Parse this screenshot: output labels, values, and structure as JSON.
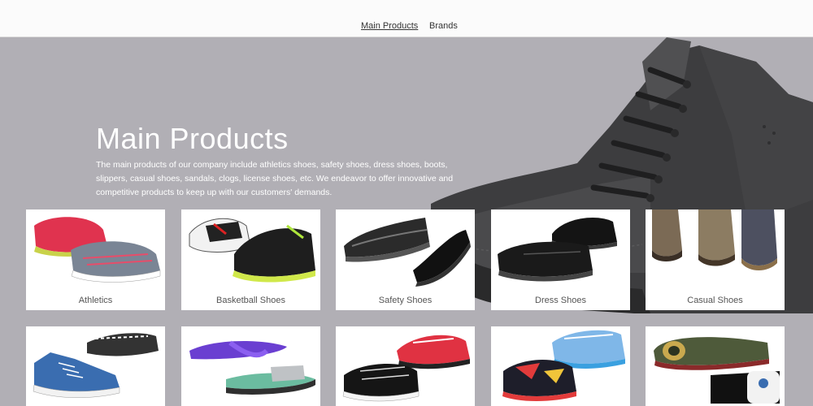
{
  "nav": {
    "items": [
      {
        "label": "Main Products",
        "active": true
      },
      {
        "label": "Brands",
        "active": false
      }
    ]
  },
  "hero": {
    "title": "Main Products",
    "description": "The main products of our company include athletics shoes, safety shoes, dress shoes, boots, slippers, casual shoes, sandals, clogs, license shoes, etc. We endeavor to offer innovative and competitive products to keep up with our customers' demands.",
    "background_color": "#b1afb5"
  },
  "products": {
    "row1": [
      {
        "label": "Athletics"
      },
      {
        "label": "Basketball Shoes"
      },
      {
        "label": "Safety Shoes"
      },
      {
        "label": "Dress Shoes"
      },
      {
        "label": "Casual Shoes"
      }
    ]
  },
  "colors": {
    "nav_bg": "#fbfbfb",
    "hero_bg": "#b1afb5",
    "card_bg": "#ececec",
    "label_bg": "#ffffff"
  }
}
